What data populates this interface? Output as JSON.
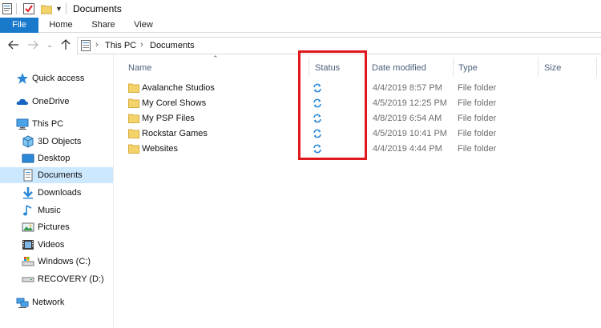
{
  "window": {
    "title": "Documents"
  },
  "ribbon": {
    "tabs": [
      "File",
      "Home",
      "Share",
      "View"
    ]
  },
  "address": {
    "crumbs": [
      "This PC",
      "Documents"
    ]
  },
  "sidebar": {
    "items": [
      {
        "label": "Quick access",
        "icon": "star-icon"
      },
      {
        "label": "OneDrive",
        "icon": "cloud-icon"
      },
      {
        "label": "This PC",
        "icon": "computer-icon"
      },
      {
        "label": "3D Objects",
        "icon": "cube-icon"
      },
      {
        "label": "Desktop",
        "icon": "desktop-icon"
      },
      {
        "label": "Documents",
        "icon": "document-icon"
      },
      {
        "label": "Downloads",
        "icon": "download-icon"
      },
      {
        "label": "Music",
        "icon": "music-icon"
      },
      {
        "label": "Pictures",
        "icon": "picture-icon"
      },
      {
        "label": "Videos",
        "icon": "video-icon"
      },
      {
        "label": "Windows (C:)",
        "icon": "drive-icon"
      },
      {
        "label": "RECOVERY (D:)",
        "icon": "drive-icon"
      },
      {
        "label": "Network",
        "icon": "network-icon"
      }
    ],
    "selected": "Documents"
  },
  "columns": {
    "name": "Name",
    "status": "Status",
    "date_modified": "Date modified",
    "type": "Type",
    "size": "Size"
  },
  "files": [
    {
      "name": "Avalanche Studios",
      "status": "sync-icon",
      "date": "4/4/2019 8:57 PM",
      "type": "File folder"
    },
    {
      "name": "My Corel Shows",
      "status": "sync-icon",
      "date": "4/5/2019 12:25 PM",
      "type": "File folder"
    },
    {
      "name": "My PSP Files",
      "status": "sync-icon",
      "date": "4/8/2019 6:54 AM",
      "type": "File folder"
    },
    {
      "name": "Rockstar Games",
      "status": "sync-icon",
      "date": "4/5/2019 10:41 PM",
      "type": "File folder"
    },
    {
      "name": "Websites",
      "status": "sync-icon",
      "date": "4/4/2019 4:44 PM",
      "type": "File folder"
    }
  ],
  "colors": {
    "accent": "#1979ca",
    "selection": "#cce8ff",
    "highlight_box": "#e0191f",
    "sync": "#2b88d8",
    "folder": "#f5d36b"
  }
}
